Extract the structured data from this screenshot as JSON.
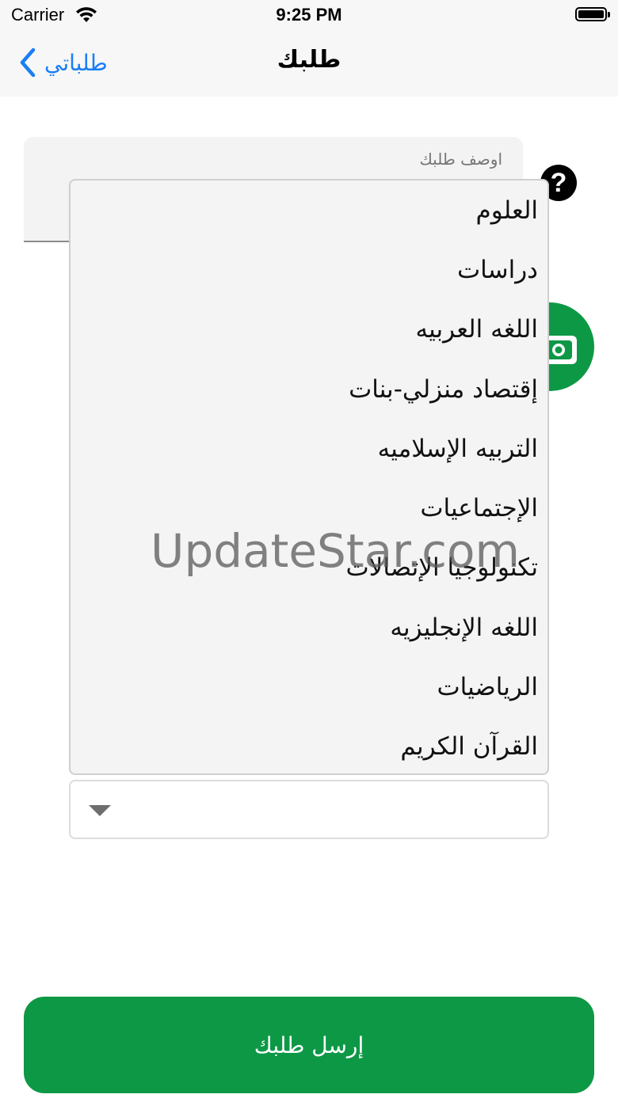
{
  "status_bar": {
    "carrier": "Carrier",
    "time": "9:25 PM"
  },
  "nav": {
    "back_label": "طلباتي",
    "title": "طلبك"
  },
  "form": {
    "description_placeholder": "اوصف طلبك",
    "subjects": [
      "العلوم",
      "دراسات",
      "اللغه العربيه",
      "إقتصاد منزلي-بنات",
      "التربيه الإسلاميه",
      "الإجتماعيات",
      "تكنولوجيا الإتصالات",
      "اللغه الإنجليزيه",
      "الرياضيات",
      "القرآن الكريم"
    ],
    "selected_subject": "",
    "submit_label": "إرسل طلبك"
  },
  "watermark": "UpdateStar.com",
  "colors": {
    "primary_green": "#0d9846",
    "ios_blue": "#1a7ef5"
  },
  "icons": {
    "help": "question-circle-icon",
    "camera": "camera-icon",
    "back": "chevron-left-icon",
    "dropdown": "caret-down-icon"
  }
}
